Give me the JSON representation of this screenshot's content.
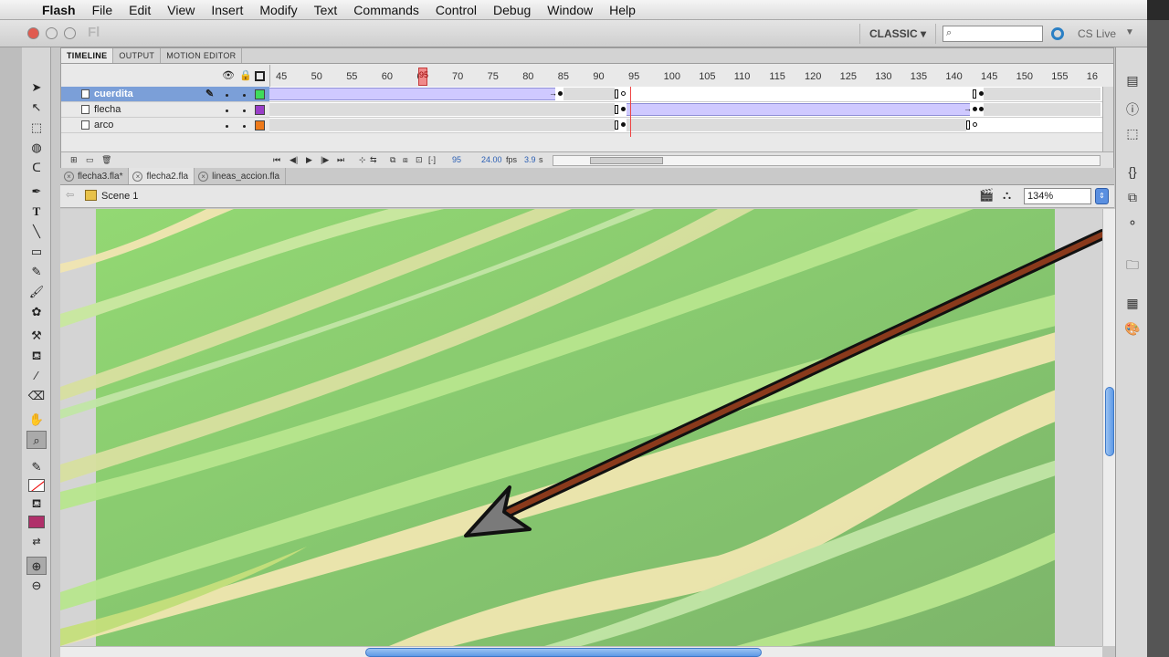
{
  "menubar": {
    "app_name": "Flash",
    "items": [
      "File",
      "Edit",
      "View",
      "Insert",
      "Modify",
      "Text",
      "Commands",
      "Control",
      "Debug",
      "Window",
      "Help"
    ]
  },
  "appbar": {
    "logo": "Fl",
    "workspace": "CLASSIC ▾",
    "search_placeholder": "",
    "cs_live": "CS Live"
  },
  "timeline": {
    "tabs": [
      "TIMELINE",
      "OUTPUT",
      "MOTION EDITOR"
    ],
    "ruler_labels": [
      "45",
      "50",
      "55",
      "60",
      "65",
      "70",
      "75",
      "80",
      "85",
      "90",
      "95",
      "100",
      "105",
      "110",
      "115",
      "120",
      "125",
      "130",
      "135",
      "140",
      "145",
      "150",
      "155",
      "16"
    ],
    "layers": [
      {
        "name": "cuerdita",
        "color": "#3fdc5a",
        "selected": true
      },
      {
        "name": "flecha",
        "color": "#9a3fc8",
        "selected": false
      },
      {
        "name": "arco",
        "color": "#ee7a1a",
        "selected": false
      }
    ],
    "footer": {
      "current_frame": "95",
      "fps": "24.00",
      "fps_unit": "fps",
      "time": "3.9",
      "time_unit": "s"
    }
  },
  "doc_tabs": [
    "flecha3.fla*",
    "flecha2.fla",
    "lineas_accion.fla"
  ],
  "editbar": {
    "scene": "Scene 1",
    "zoom": "134%"
  },
  "colors": {
    "stage_green": "#8ccf72",
    "stroke_swatch": "#ffffff",
    "fill_swatch": "#b0306a",
    "arrow_shaft": "#8a3a1c"
  }
}
